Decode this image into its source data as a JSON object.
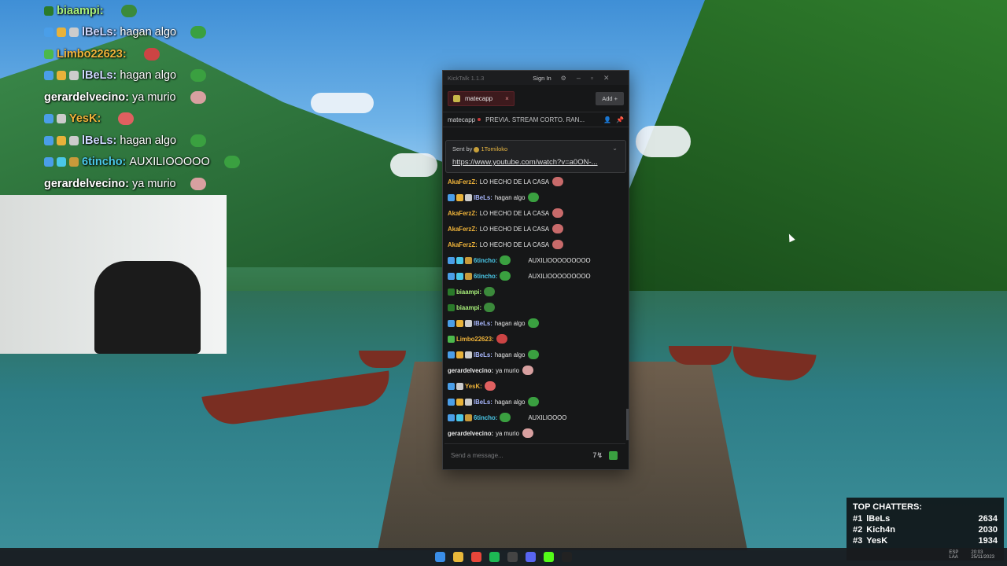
{
  "overlay_chat": [
    {
      "badges": [
        "#2a7a2a"
      ],
      "user": "biaampi:",
      "user_color": "#a8f07a",
      "text": "",
      "emote": "#3b8a3b"
    },
    {
      "badges": [
        "#4a9ee8",
        "#e8b23a",
        "#cccccc"
      ],
      "user": "lBeLs:",
      "user_color": "#cfd8ff",
      "text": "hagan algo",
      "emote": "#3aa040"
    },
    {
      "badges": [
        "#4cb84c"
      ],
      "user": "Limbo22623:",
      "user_color": "#f0b43a",
      "text": "",
      "emote": "#cc4444"
    },
    {
      "badges": [
        "#4a9ee8",
        "#e8b23a",
        "#cccccc"
      ],
      "user": "lBeLs:",
      "user_color": "#cfd8ff",
      "text": "hagan algo",
      "emote": "#3aa040"
    },
    {
      "badges": [],
      "user": "gerardelvecino:",
      "user_color": "#ffffff",
      "text": "ya murio",
      "emote": "#d8a0a0"
    },
    {
      "badges": [
        "#4a9ee8",
        "#cccccc"
      ],
      "user": "YesK:",
      "user_color": "#f0b43a",
      "text": "",
      "emote": "#e06060"
    },
    {
      "badges": [
        "#4a9ee8",
        "#e8b23a",
        "#cccccc"
      ],
      "user": "lBeLs:",
      "user_color": "#cfd8ff",
      "text": "hagan algo",
      "emote": "#3aa040"
    },
    {
      "badges": [
        "#4a9ee8",
        "#4ac8e8",
        "#c89a3a"
      ],
      "user": "6tincho:",
      "user_color": "#4ac8e8",
      "text": "AUXILIOOOOO",
      "emote": "#3aa040"
    },
    {
      "badges": [],
      "user": "gerardelvecino:",
      "user_color": "#ffffff",
      "text": "ya murio",
      "emote": "#d8a0a0"
    }
  ],
  "kicktalk": {
    "app_title": "KickTalk 1.1.3",
    "signin": "Sign In",
    "tab_label": "matecapp",
    "tab_close": "×",
    "add_label": "Add  +",
    "stream_channel": "matecapp",
    "stream_title": "PREVIA. STREAM CORTO. RAN...",
    "pinned": {
      "sent_by_label": "Sent by",
      "sent_by_user": "1Tomiloko",
      "link": "https://www.youtube.com/watch?v=a0ON-..."
    },
    "messages": [
      {
        "badges": [],
        "user": "AkaFerzZ:",
        "user_color": "#f0b43a",
        "text": "LO HECHO DE LA CASA",
        "emote": "#c86a6a"
      },
      {
        "badges": [
          "#4a9ee8",
          "#e8b23a",
          "#cccccc"
        ],
        "user": "lBeLs:",
        "user_color": "#a9b8ff",
        "text": "hagan algo",
        "emote": "#3aa040"
      },
      {
        "badges": [],
        "user": "AkaFerzZ:",
        "user_color": "#f0b43a",
        "text": "LO HECHO DE LA CASA",
        "emote": "#c86a6a"
      },
      {
        "badges": [],
        "user": "AkaFerzZ:",
        "user_color": "#f0b43a",
        "text": "LO HECHO DE LA CASA",
        "emote": "#c86a6a"
      },
      {
        "badges": [],
        "user": "AkaFerzZ:",
        "user_color": "#f0b43a",
        "text": "LO HECHO DE LA CASA",
        "emote": "#c86a6a"
      },
      {
        "badges": [
          "#4a9ee8",
          "#4ac8e8",
          "#c89a3a"
        ],
        "user": "6tincho:",
        "user_color": "#4ac8e8",
        "text": "",
        "emote": "#3aa040",
        "text2": "AUXILIOOOOOOOOO"
      },
      {
        "badges": [
          "#4a9ee8",
          "#4ac8e8",
          "#c89a3a"
        ],
        "user": "6tincho:",
        "user_color": "#4ac8e8",
        "text": "",
        "emote": "#3aa040",
        "text2": "AUXILIOOOOOOOOO"
      },
      {
        "badges": [
          "#2a7a2a"
        ],
        "user": "biaampi:",
        "user_color": "#a8f07a",
        "text": "",
        "emote": "#3b8a3b"
      },
      {
        "badges": [
          "#2a7a2a"
        ],
        "user": "biaampi:",
        "user_color": "#a8f07a",
        "text": "",
        "emote": "#3b8a3b"
      },
      {
        "badges": [
          "#4a9ee8",
          "#e8b23a",
          "#cccccc"
        ],
        "user": "lBeLs:",
        "user_color": "#a9b8ff",
        "text": "hagan algo",
        "emote": "#3aa040"
      },
      {
        "badges": [
          "#4cb84c"
        ],
        "user": "Limbo22623:",
        "user_color": "#f0b43a",
        "text": "",
        "emote": "#cc4444"
      },
      {
        "badges": [
          "#4a9ee8",
          "#e8b23a",
          "#cccccc"
        ],
        "user": "lBeLs:",
        "user_color": "#a9b8ff",
        "text": "hagan algo",
        "emote": "#3aa040"
      },
      {
        "badges": [],
        "user": "gerardelvecino:",
        "user_color": "#e6e6e6",
        "text": "ya murio",
        "emote": "#d8a0a0"
      },
      {
        "badges": [
          "#4a9ee8",
          "#cccccc"
        ],
        "user": "YesK:",
        "user_color": "#f0b43a",
        "text": "",
        "emote": "#e06060"
      },
      {
        "badges": [
          "#4a9ee8",
          "#e8b23a",
          "#cccccc"
        ],
        "user": "lBeLs:",
        "user_color": "#a9b8ff",
        "text": "hagan algo",
        "emote": "#3aa040"
      },
      {
        "badges": [
          "#4a9ee8",
          "#4ac8e8",
          "#c89a3a"
        ],
        "user": "6tincho:",
        "user_color": "#4ac8e8",
        "text": "",
        "emote": "#3aa040",
        "text2": "AUXILIOOOO"
      },
      {
        "badges": [],
        "user": "gerardelvecino:",
        "user_color": "#e6e6e6",
        "text": "ya murio",
        "emote": "#d8a0a0"
      }
    ],
    "input_placeholder": "Send a message...",
    "translate_icon": "7↯"
  },
  "top_chatters": {
    "title": "TOP CHATTERS:",
    "rows": [
      {
        "rank": "#1",
        "name": "lBeLs",
        "count": "2634"
      },
      {
        "rank": "#2",
        "name": "Kich4n",
        "count": "2030"
      },
      {
        "rank": "#3",
        "name": "YesK",
        "count": "1934"
      }
    ]
  },
  "taskbar": {
    "icons": [
      "windows-start-icon",
      "file-explorer-icon",
      "chrome-icon",
      "spotify-icon",
      "obs-icon",
      "discord-icon",
      "kick-icon",
      "epic-games-icon"
    ],
    "icon_colors": [
      "#3a8ee8",
      "#e8b83a",
      "#e8463a",
      "#1db954",
      "#444444",
      "#5865f2",
      "#53fc18",
      "#222222"
    ],
    "tray": {
      "lang": "ESP",
      "lang2": "LAA",
      "time": "20:03",
      "date": "25/11/2023"
    }
  }
}
